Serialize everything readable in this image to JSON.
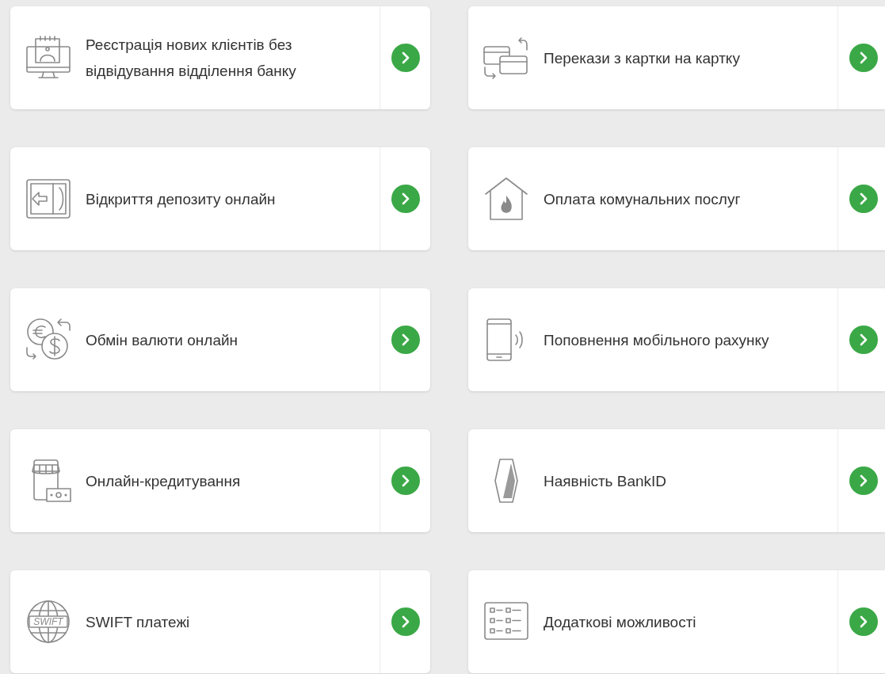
{
  "services": [
    {
      "kind": "monitor",
      "label": "Реєстрація нових клієнтів без відвідування відділення банку"
    },
    {
      "kind": "cards",
      "label": "Перекази з картки на картку"
    },
    {
      "kind": "safe",
      "label": "Відкриття депозиту онлайн"
    },
    {
      "kind": "house",
      "label": "Оплата комунальних послуг"
    },
    {
      "kind": "exchange",
      "label": "Обмін валюти онлайн"
    },
    {
      "kind": "phone",
      "label": "Поповнення мобільного рахунку"
    },
    {
      "kind": "shop",
      "label": "Онлайн-кредитування"
    },
    {
      "kind": "bankid",
      "label": "Наявність BankID"
    },
    {
      "kind": "globe",
      "label": "SWIFT платежі",
      "icon_text": "SWIFT"
    },
    {
      "kind": "list",
      "label": "Додаткові можливості"
    }
  ]
}
